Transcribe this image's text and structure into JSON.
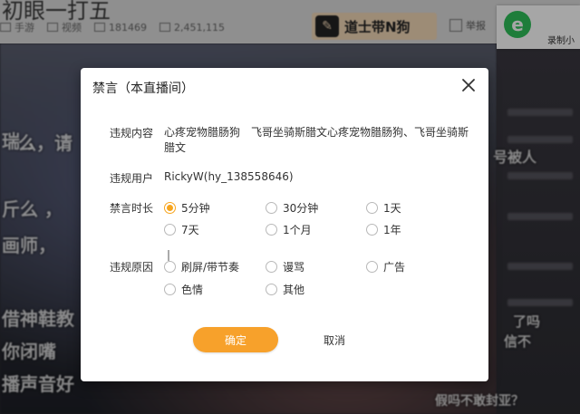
{
  "background": {
    "stream_title": "初眼一打五",
    "stats": [
      "手游",
      "视频",
      "181469",
      "2,451,115"
    ],
    "brand": "道士带N狗",
    "report": "举报",
    "recorder_label": "录制小",
    "danmaku": [
      "瑞 ，",
      "么，请",
      "斤么 ，",
      "画师，",
      "借神鞋教",
      "你闭嘴",
      "播声音好",
      "号被人",
      "了吗",
      "信不",
      "假吗不敢封亚？"
    ]
  },
  "dialog": {
    "title": "禁言（本直播间）",
    "violation_content_label": "违规内容",
    "violation_content": "心疼宠物腊肠狗　飞哥坐骑斯腊文心疼宠物腊肠狗、飞哥坐骑斯腊文",
    "violation_user_label": "违规用户",
    "violation_user": "RickyW(hy_138558646)",
    "duration_label": "禁言时长",
    "duration_options": [
      "5分钟",
      "30分钟",
      "1天",
      "7天",
      "1个月",
      "1年"
    ],
    "duration_selected": "5分钟",
    "reason_label": "违规原因",
    "reason_options": [
      "刷屏/带节奏",
      "谩骂",
      "广告",
      "色情",
      "其他"
    ],
    "confirm_label": "确定",
    "cancel_label": "取消"
  },
  "colors": {
    "accent": "#f7a12b",
    "radio_selected": "#f7a51e"
  },
  "icons": {
    "close": "close-icon",
    "recorder": "recorder-e-icon"
  }
}
